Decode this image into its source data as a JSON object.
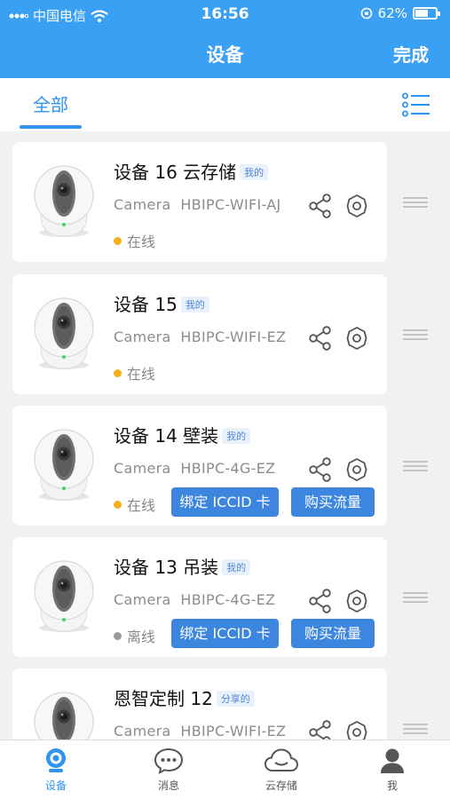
{
  "status_bar": {
    "carrier": "中国电信",
    "time": "16:56",
    "battery": "62%",
    "battery_level": 0.62
  },
  "header": {
    "title": "设备",
    "done_label": "完成"
  },
  "tabs": {
    "all_label": "全部"
  },
  "devices": [
    {
      "name": "设备 16 云存储",
      "tag": "我的",
      "type": "Camera",
      "model": "HBIPC-WIFI-AJ",
      "status": "在线",
      "status_color": "#f2b01e",
      "iccid_label": "",
      "flow_label": ""
    },
    {
      "name": "设备 15",
      "tag": "我的",
      "type": "Camera",
      "model": "HBIPC-WIFI-EZ",
      "status": "在线",
      "status_color": "#f2b01e",
      "iccid_label": "",
      "flow_label": ""
    },
    {
      "name": "设备 14 壁装",
      "tag": "我的",
      "type": "Camera",
      "model": "HBIPC-4G-EZ",
      "status": "在线",
      "status_color": "#f2b01e",
      "iccid_label": "绑定 ICCID 卡",
      "flow_label": "购买流量"
    },
    {
      "name": "设备 13 吊装",
      "tag": "我的",
      "type": "Camera",
      "model": "HBIPC-4G-EZ",
      "status": "离线",
      "status_color": "#9a9a9a",
      "iccid_label": "绑定 ICCID 卡",
      "flow_label": "购买流量"
    },
    {
      "name": "恩智定制 12",
      "tag": "分享的",
      "type": "Camera",
      "model": "HBIPC-WIFI-EZ",
      "status": "",
      "status_color": "#f2b01e",
      "iccid_label": "",
      "flow_label": ""
    }
  ],
  "bottom_nav": [
    {
      "label": "设备",
      "icon": "device-icon",
      "active": true
    },
    {
      "label": "消息",
      "icon": "message-icon",
      "active": false
    },
    {
      "label": "云存储",
      "icon": "cloud-icon",
      "active": false
    },
    {
      "label": "我",
      "icon": "profile-icon",
      "active": false
    }
  ],
  "colors": {
    "primary": "#3aa0f4",
    "accent": "#2f93f0",
    "button": "#3d86e0",
    "online": "#f2b01e",
    "offline": "#9a9a9a"
  }
}
